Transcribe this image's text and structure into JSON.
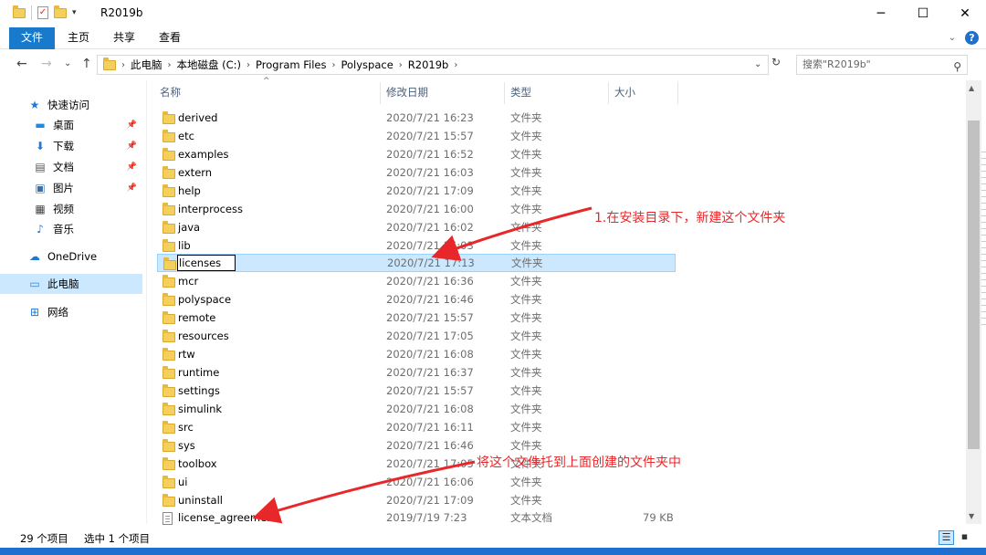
{
  "window": {
    "title": "R2019b",
    "minimize": "─",
    "maximize": "☐",
    "close": "✕"
  },
  "ribbon": {
    "tabs": [
      {
        "label": "文件",
        "active": true
      },
      {
        "label": "主页",
        "active": false
      },
      {
        "label": "共享",
        "active": false
      },
      {
        "label": "查看",
        "active": false
      }
    ],
    "help": "?"
  },
  "nav": {
    "back": "←",
    "forward": "→",
    "recent": "⌄",
    "up": "↑",
    "breadcrumbs": [
      "此电脑",
      "本地磁盘 (C:)",
      "Program Files",
      "Polyspace",
      "R2019b"
    ],
    "search_placeholder": "搜索\"R2019b\""
  },
  "sidebar": {
    "items": [
      {
        "label": "快速访问",
        "icon": "star-icon",
        "glyph": "★",
        "color": "#1e78d6",
        "pinned": false,
        "selected": false
      },
      {
        "label": "桌面",
        "icon": "desktop-icon",
        "glyph": "▬",
        "color": "#1e88e5",
        "pinned": true,
        "selected": false
      },
      {
        "label": "下载",
        "icon": "download-icon",
        "glyph": "⬇",
        "color": "#1e78d6",
        "pinned": true,
        "selected": false
      },
      {
        "label": "文档",
        "icon": "document-icon",
        "glyph": "▤",
        "color": "#555",
        "pinned": true,
        "selected": false
      },
      {
        "label": "图片",
        "icon": "picture-icon",
        "glyph": "▣",
        "color": "#3a6ea5",
        "pinned": true,
        "selected": false
      },
      {
        "label": "视频",
        "icon": "video-icon",
        "glyph": "▦",
        "color": "#444",
        "pinned": false,
        "selected": false
      },
      {
        "label": "音乐",
        "icon": "music-icon",
        "glyph": "♪",
        "color": "#1e78d6",
        "pinned": false,
        "selected": false
      },
      {
        "label": "OneDrive",
        "icon": "cloud-icon",
        "glyph": "☁",
        "color": "#1e78d6",
        "pinned": false,
        "selected": false
      },
      {
        "label": "此电脑",
        "icon": "computer-icon",
        "glyph": "▭",
        "color": "#1e88e5",
        "pinned": false,
        "selected": true
      },
      {
        "label": "网络",
        "icon": "network-icon",
        "glyph": "⊞",
        "color": "#1e78d6",
        "pinned": false,
        "selected": false
      }
    ]
  },
  "columns": {
    "name": "名称",
    "date": "修改日期",
    "type": "类型",
    "size": "大小"
  },
  "files": [
    {
      "name": "derived",
      "date": "2020/7/21 16:23",
      "type": "文件夹",
      "size": "",
      "kind": "folder"
    },
    {
      "name": "etc",
      "date": "2020/7/21 15:57",
      "type": "文件夹",
      "size": "",
      "kind": "folder"
    },
    {
      "name": "examples",
      "date": "2020/7/21 16:52",
      "type": "文件夹",
      "size": "",
      "kind": "folder"
    },
    {
      "name": "extern",
      "date": "2020/7/21 16:03",
      "type": "文件夹",
      "size": "",
      "kind": "folder"
    },
    {
      "name": "help",
      "date": "2020/7/21 17:09",
      "type": "文件夹",
      "size": "",
      "kind": "folder"
    },
    {
      "name": "interprocess",
      "date": "2020/7/21 16:00",
      "type": "文件夹",
      "size": "",
      "kind": "folder"
    },
    {
      "name": "java",
      "date": "2020/7/21 16:02",
      "type": "文件夹",
      "size": "",
      "kind": "folder"
    },
    {
      "name": "lib",
      "date": "2020/7/21 16:03",
      "type": "文件夹",
      "size": "",
      "kind": "folder"
    },
    {
      "name": "licenses",
      "date": "2020/7/21 17:13",
      "type": "文件夹",
      "size": "",
      "kind": "folder",
      "selected": true
    },
    {
      "name": "mcr",
      "date": "2020/7/21 16:36",
      "type": "文件夹",
      "size": "",
      "kind": "folder"
    },
    {
      "name": "polyspace",
      "date": "2020/7/21 16:46",
      "type": "文件夹",
      "size": "",
      "kind": "folder"
    },
    {
      "name": "remote",
      "date": "2020/7/21 15:57",
      "type": "文件夹",
      "size": "",
      "kind": "folder"
    },
    {
      "name": "resources",
      "date": "2020/7/21 17:05",
      "type": "文件夹",
      "size": "",
      "kind": "folder"
    },
    {
      "name": "rtw",
      "date": "2020/7/21 16:08",
      "type": "文件夹",
      "size": "",
      "kind": "folder"
    },
    {
      "name": "runtime",
      "date": "2020/7/21 16:37",
      "type": "文件夹",
      "size": "",
      "kind": "folder"
    },
    {
      "name": "settings",
      "date": "2020/7/21 15:57",
      "type": "文件夹",
      "size": "",
      "kind": "folder"
    },
    {
      "name": "simulink",
      "date": "2020/7/21 16:08",
      "type": "文件夹",
      "size": "",
      "kind": "folder"
    },
    {
      "name": "src",
      "date": "2020/7/21 16:11",
      "type": "文件夹",
      "size": "",
      "kind": "folder"
    },
    {
      "name": "sys",
      "date": "2020/7/21 16:46",
      "type": "文件夹",
      "size": "",
      "kind": "folder"
    },
    {
      "name": "toolbox",
      "date": "2020/7/21 17:05",
      "type": "文件夹",
      "size": "",
      "kind": "folder"
    },
    {
      "name": "ui",
      "date": "2020/7/21 16:06",
      "type": "文件夹",
      "size": "",
      "kind": "folder"
    },
    {
      "name": "uninstall",
      "date": "2020/7/21 17:09",
      "type": "文件夹",
      "size": "",
      "kind": "folder"
    },
    {
      "name": "license_agreement",
      "date": "2019/7/19 7:23",
      "type": "文本文档",
      "size": "79 KB",
      "kind": "text"
    }
  ],
  "status": {
    "count": "29 个项目",
    "selection": "选中 1 个项目"
  },
  "annotations": {
    "note1": "1.在安装目录下，新建这个文件夹",
    "note2": "将这个文件托到上面创建的文件夹中",
    "color": "#e8272a"
  }
}
